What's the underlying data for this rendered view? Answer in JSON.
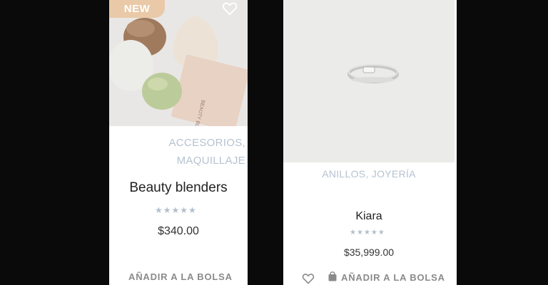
{
  "products": [
    {
      "badge": "NEW",
      "categories": [
        "ACCESORIOS,",
        "MAQUILLAJE"
      ],
      "title": "Beauty blenders",
      "rating_stars": 5,
      "rating_value": 0,
      "price": "$340.00",
      "add_to_cart": "AÑADIR A LA BOLSA",
      "wishlist_icon": "heart-outline-icon"
    },
    {
      "categories": [
        "ANILLOS, JOYERÍA"
      ],
      "title": "Kiara",
      "rating_stars": 5,
      "rating_value": 0,
      "price": "$35,999.00",
      "add_to_cart": "AÑADIR A LA BOLSA",
      "wishlist_icon": "heart-outline-icon",
      "cart_icon": "shopping-bag-icon"
    }
  ],
  "colors": {
    "background": "#0a0a0a",
    "card": "#ffffff",
    "badge": "#e9c9a8",
    "category": "#b6c3d1",
    "stars": "#b3bfcc",
    "button_text": "#8a8a8a"
  }
}
